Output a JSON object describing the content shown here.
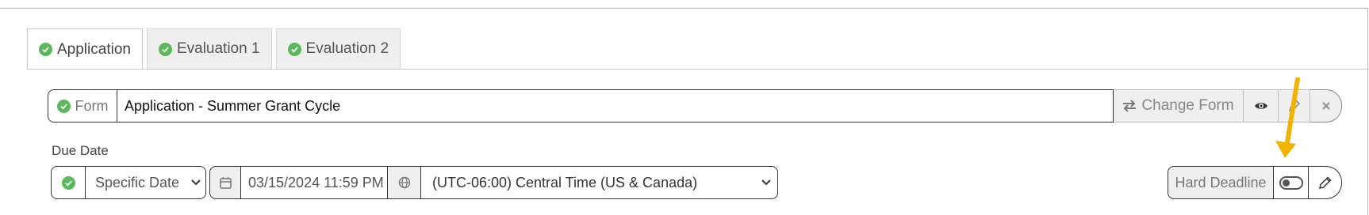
{
  "tabs": [
    {
      "label": "Application",
      "active": true
    },
    {
      "label": "Evaluation 1",
      "active": false
    },
    {
      "label": "Evaluation 2",
      "active": false
    }
  ],
  "form": {
    "addon_label": "Form",
    "value": "Application - Summer Grant Cycle",
    "change_label": "Change Form"
  },
  "due_date": {
    "label": "Due Date",
    "type_value": "Specific Date",
    "date_value": "03/15/2024 11:59 PM",
    "timezone_value": "(UTC-06:00) Central Time (US & Canada)"
  },
  "hard_deadline": {
    "label": "Hard Deadline",
    "enabled": false
  },
  "colors": {
    "check_green": "#5cb85c",
    "annotation_arrow": "#f0b400"
  }
}
